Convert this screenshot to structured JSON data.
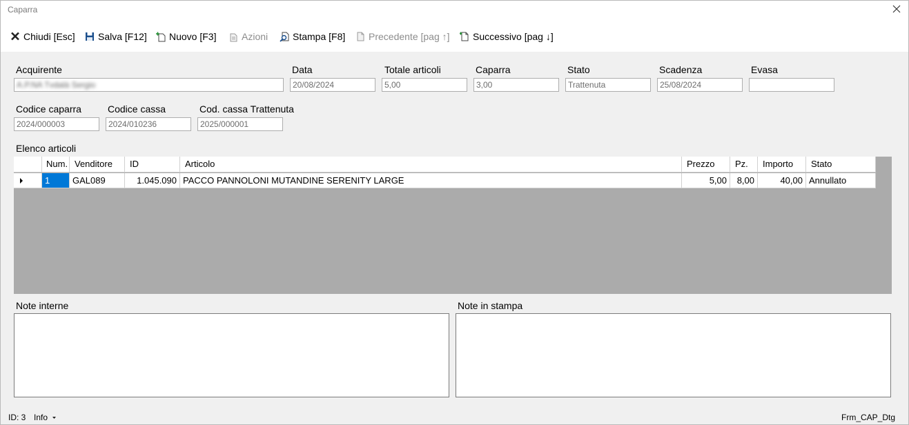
{
  "window": {
    "title": "Caparra",
    "close_icon": "close-icon"
  },
  "toolbar": {
    "items": [
      {
        "label": "Chiudi [Esc]",
        "icon": "close-x-icon",
        "enabled": true
      },
      {
        "label": "Salva [F12]",
        "icon": "save-icon",
        "enabled": true
      },
      {
        "label": "Nuovo [F3]",
        "icon": "new-document-icon",
        "enabled": true
      },
      {
        "label": "Azioni",
        "icon": "actions-icon",
        "enabled": false
      },
      {
        "label": "Stampa [F8]",
        "icon": "print-preview-icon",
        "enabled": true
      },
      {
        "label": "Precedente [pag ↑]",
        "icon": "previous-document-icon",
        "enabled": false
      },
      {
        "label": "Successivo [pag ↓]",
        "icon": "next-document-icon",
        "enabled": true
      }
    ]
  },
  "form": {
    "acquirente": {
      "label": "Acquirente",
      "value": "A.P.NA Tvdalà Sergio"
    },
    "data": {
      "label": "Data",
      "value": "20/08/2024"
    },
    "totale_articoli": {
      "label": "Totale articoli",
      "value": "5,00"
    },
    "caparra": {
      "label": "Caparra",
      "value": "3,00"
    },
    "stato": {
      "label": "Stato",
      "value": "Trattenuta"
    },
    "scadenza": {
      "label": "Scadenza",
      "value": "25/08/2024"
    },
    "evasa": {
      "label": "Evasa",
      "value": ""
    },
    "codice_caparra": {
      "label": "Codice caparra",
      "value": "2024/000003"
    },
    "codice_cassa": {
      "label": "Codice cassa",
      "value": "2024/010236"
    },
    "cod_cassa_trattenuta": {
      "label": "Cod. cassa Trattenuta",
      "value": "2025/000001"
    }
  },
  "articles": {
    "label": "Elenco articoli",
    "columns": [
      "Num.",
      "Venditore",
      "ID",
      "Articolo",
      "Prezzo",
      "Pz.",
      "Importo",
      "Stato"
    ],
    "rows": [
      {
        "num": "1",
        "venditore": "GAL089",
        "id": "1.045.090",
        "articolo": "PACCO PANNOLONI MUTANDINE SERENITY LARGE",
        "prezzo": "5,00",
        "pz": "8,00",
        "importo": "40,00",
        "stato": "Annullato"
      }
    ]
  },
  "notes": {
    "interne": {
      "label": "Note interne",
      "value": ""
    },
    "stampa": {
      "label": "Note in stampa",
      "value": ""
    }
  },
  "status_bar": {
    "id_text": "ID: 3",
    "info_label": "Info",
    "form_name": "Frm_CAP_Dtg"
  }
}
